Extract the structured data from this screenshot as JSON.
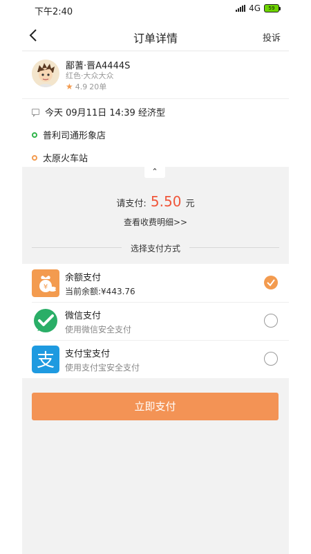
{
  "status_bar": {
    "time": "下午2:40",
    "network": "4G",
    "battery": "59"
  },
  "header": {
    "title": "订单详情",
    "complain_label": "投诉"
  },
  "driver": {
    "plate": "鄙蓍·晋A4444S",
    "car": "红色·大众大众",
    "rating": "4.9",
    "orders": "20单"
  },
  "order": {
    "time_type": "今天 09月11日 14:39 经济型",
    "start": "普利司通形象店",
    "end": "太原火车站"
  },
  "payment": {
    "pay_label": "请支付:",
    "amount": "5.50",
    "unit": "元",
    "fee_detail_link": "查看收费明细>>",
    "method_title": "选择支付方式",
    "options": [
      {
        "title": "余额支付",
        "subtitle": "当前余额:¥443.76",
        "icon": "wallet-icon",
        "selected": true,
        "color": "#f39b4f"
      },
      {
        "title": "微信支付",
        "subtitle": "使用微信安全支付",
        "icon": "wechat-icon",
        "selected": false,
        "color": "#2aae67"
      },
      {
        "title": "支付宝支付",
        "subtitle": "使用支付宝安全支付",
        "icon": "alipay-icon",
        "selected": false,
        "color": "#1e9ae0"
      }
    ],
    "pay_button": "立即支付"
  },
  "colors": {
    "accent": "#f39355",
    "price": "#f0563a"
  }
}
